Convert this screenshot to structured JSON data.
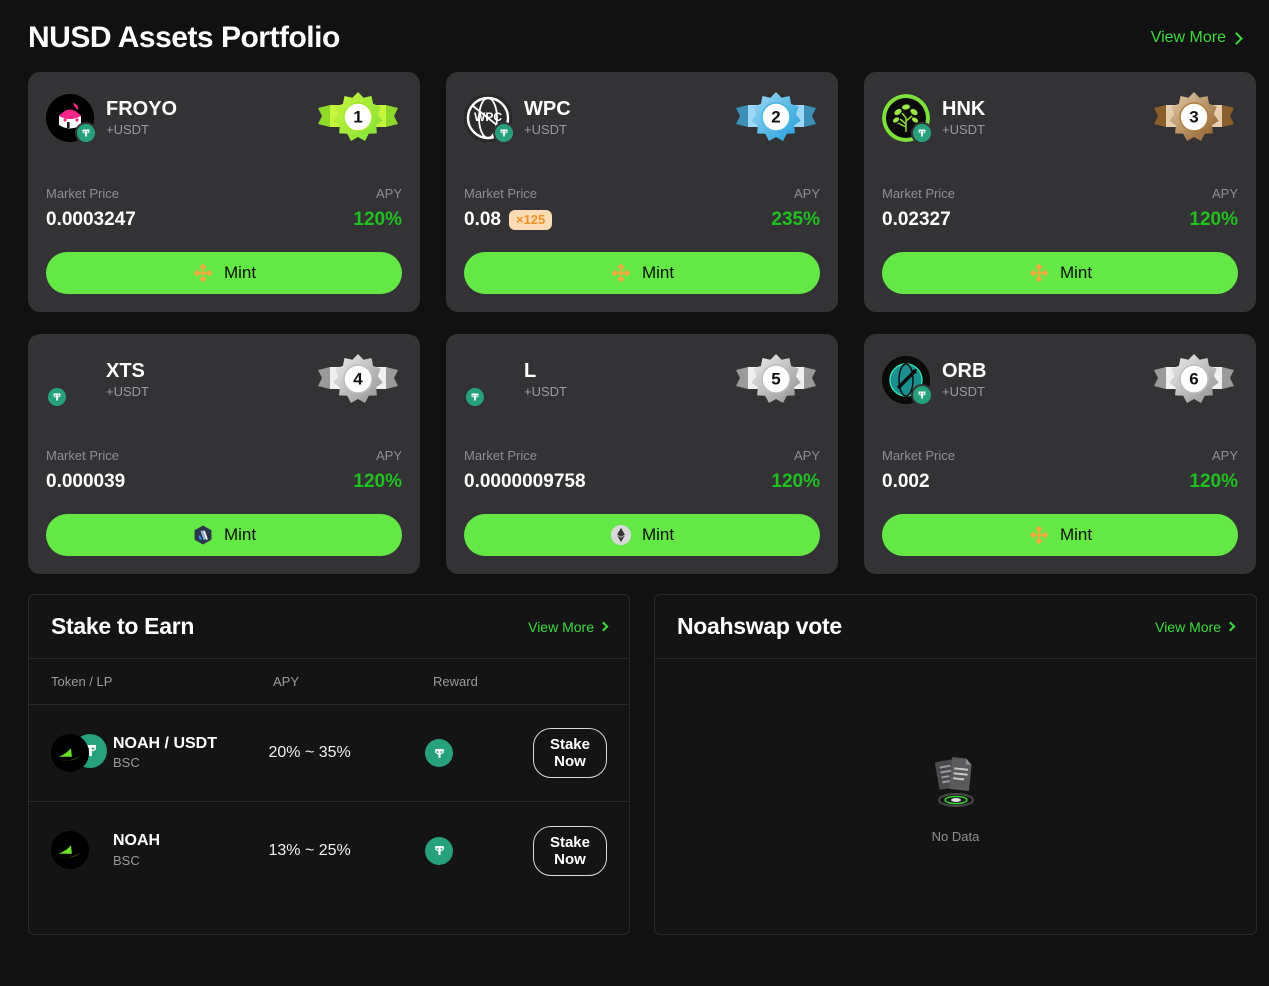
{
  "portfolio": {
    "title": "NUSD Assets Portfolio",
    "view_more": "View More",
    "labels": {
      "market_price": "Market Price",
      "apy": "APY",
      "mint": "Mint"
    },
    "accent_green": "#64e845",
    "apy_green": "#20c020",
    "assets": [
      {
        "rank": "1",
        "rank_color": "gold",
        "name": "FROYO",
        "pair": "+USDT",
        "market_price": "0.0003247",
        "multiplier": null,
        "apy": "120%",
        "mint": "Mint",
        "chain_icon": "binance-icon",
        "logo": "froyo-logo"
      },
      {
        "rank": "2",
        "rank_color": "blue",
        "name": "WPC",
        "pair": "+USDT",
        "market_price": "0.08",
        "multiplier": "×125",
        "apy": "235%",
        "mint": "Mint",
        "chain_icon": "binance-icon",
        "logo": "wpc-logo"
      },
      {
        "rank": "3",
        "rank_color": "bronze",
        "name": "HNK",
        "pair": "+USDT",
        "market_price": "0.02327",
        "multiplier": null,
        "apy": "120%",
        "mint": "Mint",
        "chain_icon": "binance-icon",
        "logo": "hnk-logo"
      },
      {
        "rank": "4",
        "rank_color": "silver",
        "name": "XTS",
        "pair": "+USDT",
        "market_price": "0.000039",
        "multiplier": null,
        "apy": "120%",
        "mint": "Mint",
        "chain_icon": "arbitrum-icon",
        "logo": "none"
      },
      {
        "rank": "5",
        "rank_color": "silver",
        "name": "L",
        "pair": "+USDT",
        "market_price": "0.0000009758",
        "multiplier": null,
        "apy": "120%",
        "mint": "Mint",
        "chain_icon": "ethereum-icon",
        "logo": "none"
      },
      {
        "rank": "6",
        "rank_color": "silver",
        "name": "ORB",
        "pair": "+USDT",
        "market_price": "0.002",
        "multiplier": null,
        "apy": "120%",
        "mint": "Mint",
        "chain_icon": "binance-icon",
        "logo": "orb-logo"
      }
    ]
  },
  "stake": {
    "title": "Stake to Earn",
    "view_more": "View More",
    "columns": {
      "token": "Token / LP",
      "apy": "APY",
      "reward": "Reward"
    },
    "rows": [
      {
        "name": "NOAH / USDT",
        "chain": "BSC",
        "apy": "20% ~ 35%",
        "reward_icon": "usdt-icon",
        "action": "Stake Now",
        "pair": true
      },
      {
        "name": "NOAH",
        "chain": "BSC",
        "apy": "13% ~ 25%",
        "reward_icon": "usdt-icon",
        "action": "Stake Now",
        "pair": false
      }
    ]
  },
  "vote": {
    "title": "Noahswap vote",
    "view_more": "View More",
    "empty_text": "No Data",
    "empty_icon": "no-data-document-icon"
  }
}
